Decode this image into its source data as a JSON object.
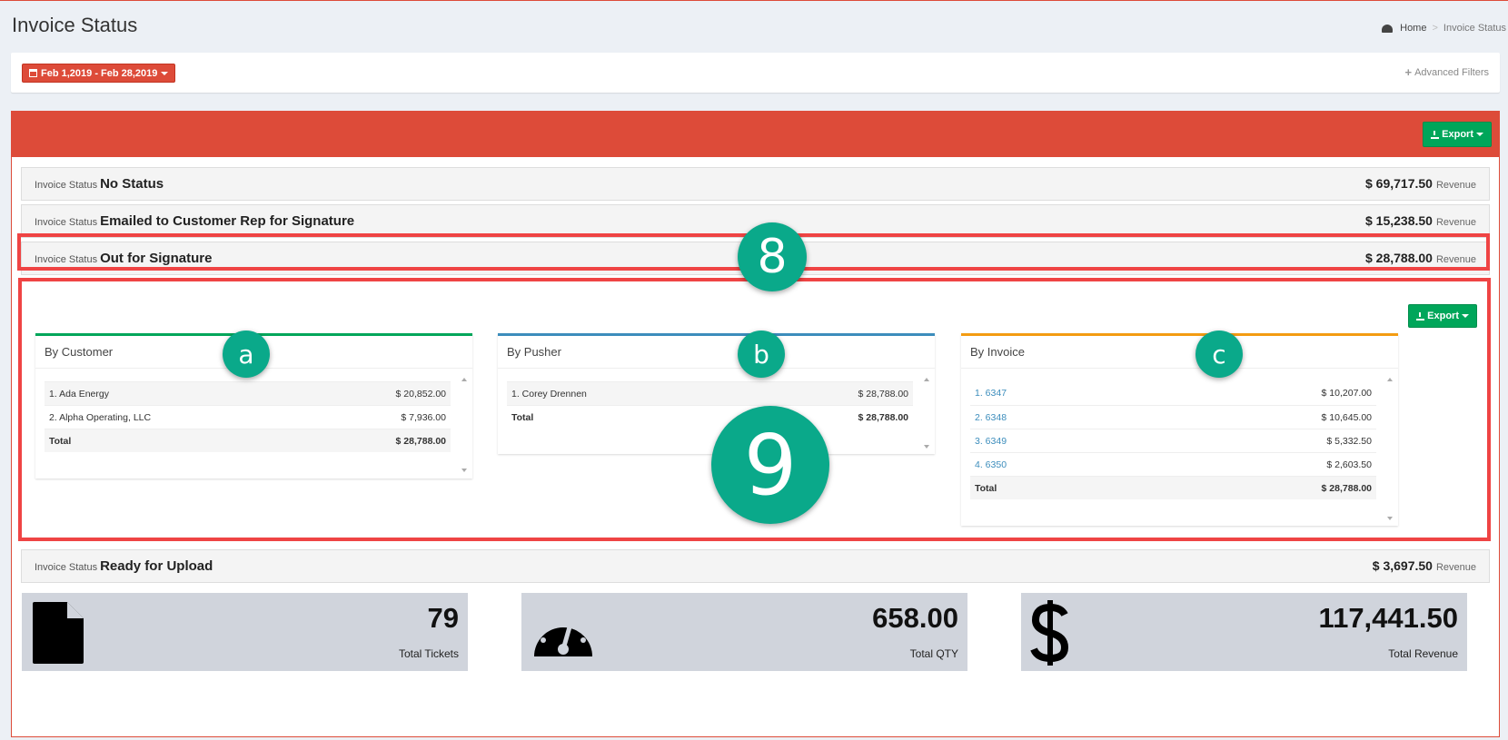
{
  "header": {
    "title": "Invoice Status"
  },
  "breadcrumb": {
    "home": "Home",
    "sep": ">",
    "current": "Invoice Status"
  },
  "filters": {
    "date_range": "Feb 1,2019 - Feb 28,2019",
    "advanced": "Advanced Filters"
  },
  "export_label": "Export",
  "status_rows": [
    {
      "label": "Invoice Status",
      "name": "No Status",
      "amount": "$ 69,717.50",
      "suffix": "Revenue"
    },
    {
      "label": "Invoice Status",
      "name": "Emailed to Customer Rep for Signature",
      "amount": "$ 15,238.50",
      "suffix": "Revenue"
    },
    {
      "label": "Invoice Status",
      "name": "Out for Signature",
      "amount": "$ 28,788.00",
      "suffix": "Revenue"
    },
    {
      "label": "Invoice Status",
      "name": "Ready for Upload",
      "amount": "$ 3,697.50",
      "suffix": "Revenue"
    }
  ],
  "panels": {
    "customer": {
      "title": "By Customer",
      "color": "#00a65a",
      "rows": [
        {
          "name": "1. Ada Energy",
          "value": "$ 20,852.00"
        },
        {
          "name": "2. Alpha Operating, LLC",
          "value": "$ 7,936.00"
        }
      ],
      "total_label": "Total",
      "total": "$ 28,788.00"
    },
    "pusher": {
      "title": "By Pusher",
      "color": "#3c8dbc",
      "rows": [
        {
          "name": "1. Corey Drennen",
          "value": "$ 28,788.00"
        }
      ],
      "total_label": "Total",
      "total": "$ 28,788.00"
    },
    "invoice": {
      "title": "By Invoice",
      "color": "#f39c12",
      "rows": [
        {
          "name": "1. 6347",
          "value": "$ 10,207.00"
        },
        {
          "name": "2. 6348",
          "value": "$ 10,645.00"
        },
        {
          "name": "3. 6349",
          "value": "$ 5,332.50"
        },
        {
          "name": "4. 6350",
          "value": "$ 2,603.50"
        }
      ],
      "total_label": "Total",
      "total": "$ 28,788.00"
    }
  },
  "annotations": {
    "b8": "8",
    "b9": "9",
    "ba": "a",
    "bb": "b",
    "bc": "c"
  },
  "stats": [
    {
      "value": "79",
      "caption": "Total Tickets",
      "icon": "file-icon"
    },
    {
      "value": "658.00",
      "caption": "Total QTY",
      "icon": "dashboard-icon"
    },
    {
      "value": "117,441.50",
      "caption": "Total Revenue",
      "icon": "dollar-icon"
    }
  ],
  "colors": {
    "accent_red": "#dd4b39",
    "export_green": "#00a65a",
    "badge_teal": "#0aa98a",
    "highlight_red": "#ef4444"
  }
}
